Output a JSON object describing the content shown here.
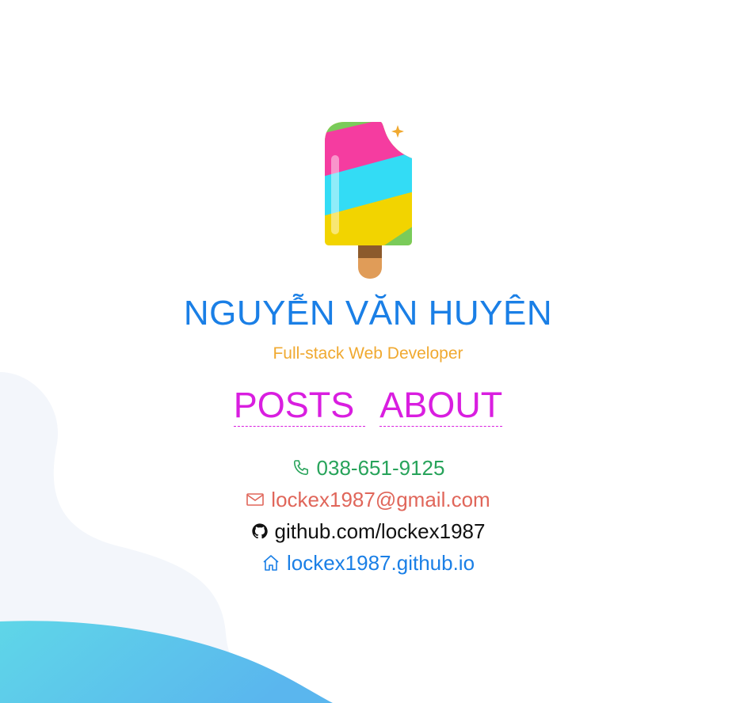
{
  "profile": {
    "name": "NGUYỄN VĂN HUYÊN",
    "tagline": "Full-stack Web Developer"
  },
  "nav": {
    "posts_label": "POSTS",
    "about_label": "ABOUT"
  },
  "contacts": {
    "phone": "038-651-9125",
    "email": "lockex1987@gmail.com",
    "github": "github.com/lockex1987",
    "website": "lockex1987.github.io"
  },
  "colors": {
    "name": "#1a7fe6",
    "tagline": "#f0a930",
    "nav": "#d91ee0",
    "phone": "#27a35a",
    "email": "#e0665a",
    "github": "#111111",
    "website": "#1a7fe6"
  },
  "icons": {
    "logo": "popsicle-logo",
    "phone": "phone-icon",
    "email": "mail-icon",
    "github": "github-icon",
    "website": "home-icon"
  }
}
